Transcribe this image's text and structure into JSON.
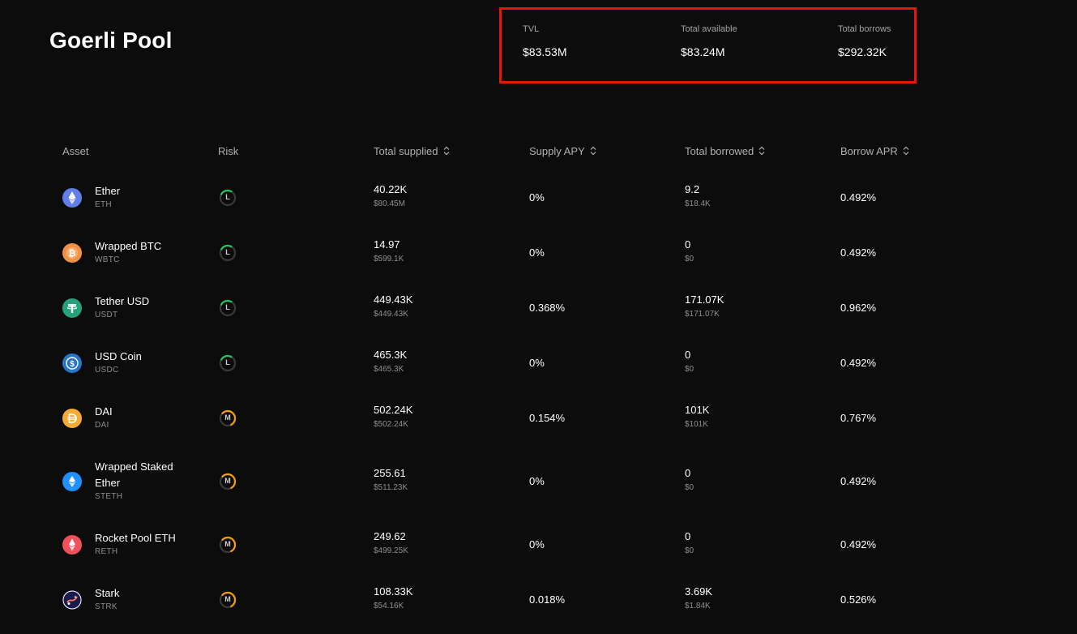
{
  "pool": {
    "title": "Goerli Pool"
  },
  "stats": [
    {
      "label": "TVL",
      "value": "$83.53M"
    },
    {
      "label": "Total available",
      "value": "$83.24M"
    },
    {
      "label": "Total borrows",
      "value": "$292.32K"
    }
  ],
  "colors": {
    "highlight": "#e3180b",
    "risk_low": "#22c55e",
    "risk_medium": "#f59e0b"
  },
  "table": {
    "headers": {
      "asset": "Asset",
      "risk": "Risk",
      "total_supplied": "Total supplied",
      "supply_apy": "Supply APY",
      "total_borrowed": "Total borrowed",
      "borrow_apr": "Borrow APR"
    },
    "rows": [
      {
        "name": "Ether",
        "symbol": "ETH",
        "icon": "ethereum-icon",
        "icon_color": "#627eea",
        "risk": "L",
        "supplied": "40.22K",
        "supplied_usd": "$80.45M",
        "supply_apy": "0%",
        "borrowed": "9.2",
        "borrowed_usd": "$18.4K",
        "borrow_apr": "0.492%"
      },
      {
        "name": "Wrapped BTC",
        "symbol": "WBTC",
        "icon": "bitcoin-icon",
        "icon_color": "#f09242",
        "risk": "L",
        "supplied": "14.97",
        "supplied_usd": "$599.1K",
        "supply_apy": "0%",
        "borrowed": "0",
        "borrowed_usd": "$0",
        "borrow_apr": "0.492%"
      },
      {
        "name": "Tether USD",
        "symbol": "USDT",
        "icon": "tether-icon",
        "icon_color": "#26a17b",
        "risk": "L",
        "supplied": "449.43K",
        "supplied_usd": "$449.43K",
        "supply_apy": "0.368%",
        "borrowed": "171.07K",
        "borrowed_usd": "$171.07K",
        "borrow_apr": "0.962%"
      },
      {
        "name": "USD Coin",
        "symbol": "USDC",
        "icon": "usdc-icon",
        "icon_color": "#2775ca",
        "risk": "L",
        "supplied": "465.3K",
        "supplied_usd": "$465.3K",
        "supply_apy": "0%",
        "borrowed": "0",
        "borrowed_usd": "$0",
        "borrow_apr": "0.492%"
      },
      {
        "name": "DAI",
        "symbol": "DAI",
        "icon": "dai-icon",
        "icon_color": "#f5ac37",
        "risk": "M",
        "supplied": "502.24K",
        "supplied_usd": "$502.24K",
        "supply_apy": "0.154%",
        "borrowed": "101K",
        "borrowed_usd": "$101K",
        "borrow_apr": "0.767%"
      },
      {
        "name": "Wrapped Staked Ether",
        "symbol": "STETH",
        "icon": "wsteth-icon",
        "icon_color": "#1e90ff",
        "risk": "M",
        "supplied": "255.61",
        "supplied_usd": "$511.23K",
        "supply_apy": "0%",
        "borrowed": "0",
        "borrowed_usd": "$0",
        "borrow_apr": "0.492%"
      },
      {
        "name": "Rocket Pool ETH",
        "symbol": "RETH",
        "icon": "rocket-pool-icon",
        "icon_color": "#f0505a",
        "risk": "M",
        "supplied": "249.62",
        "supplied_usd": "$499.25K",
        "supply_apy": "0%",
        "borrowed": "0",
        "borrowed_usd": "$0",
        "borrow_apr": "0.492%"
      },
      {
        "name": "Stark",
        "symbol": "STRK",
        "icon": "starknet-icon",
        "icon_color": "#1c1b4f",
        "risk": "M",
        "supplied": "108.33K",
        "supplied_usd": "$54.16K",
        "supply_apy": "0.018%",
        "borrowed": "3.69K",
        "borrowed_usd": "$1.84K",
        "borrow_apr": "0.526%"
      }
    ]
  }
}
